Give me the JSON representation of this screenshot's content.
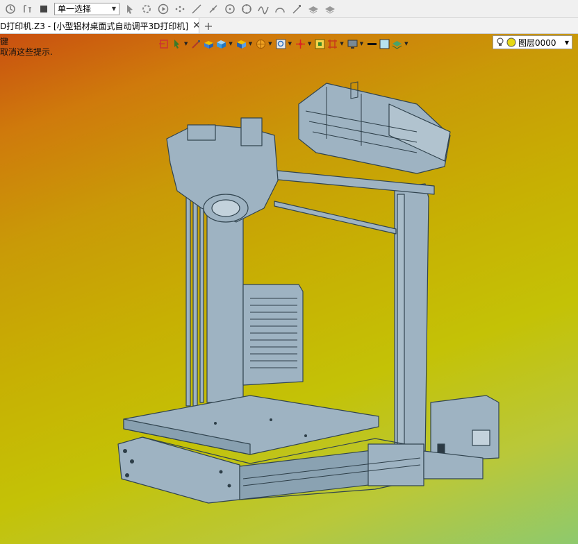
{
  "toolbar": {
    "icons": [
      "rotate-icon",
      "history-icon",
      "stop-icon",
      "select-filter-icon",
      "move-icon",
      "play-icon",
      "pattern-icon",
      "line-icon",
      "measure-icon",
      "circle-center-icon",
      "circle-icon",
      "curve-icon",
      "arc-icon",
      "tool-icon",
      "layer-icon-1",
      "layer-icon-2"
    ],
    "select_value": "单一选择"
  },
  "tab": {
    "label": "D打印机.Z3 - [小型铝材桌面式自动调平3D打印机]",
    "close_glyph": "✕",
    "add_glyph": "+"
  },
  "viewport": {
    "hint_line1": "键",
    "hint_line2": "取消这些提示.",
    "layer_value": "图层0000",
    "bg_colors": [
      "#c94f10",
      "#c7b003",
      "#8ec96d"
    ]
  },
  "model": {
    "fill": "#9eb3c2",
    "stroke": "#31444f"
  }
}
